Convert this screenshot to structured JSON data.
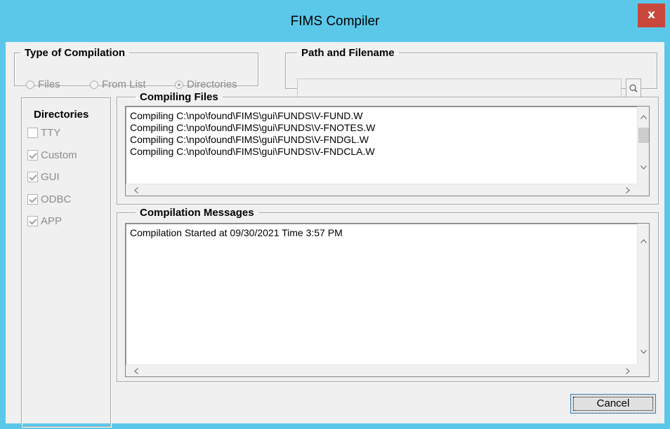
{
  "window": {
    "title": "FIMS Compiler",
    "close_label": "x"
  },
  "compilation_type": {
    "legend": "Type of Compilation",
    "options": [
      {
        "label": "Files",
        "selected": false
      },
      {
        "label": "From List",
        "selected": false
      },
      {
        "label": "Directories",
        "selected": true
      }
    ]
  },
  "path": {
    "legend": "Path and Filename",
    "value": "",
    "browse_icon": "search-icon"
  },
  "directories": {
    "heading": "Directories",
    "items": [
      {
        "label": "TTY",
        "checked": false
      },
      {
        "label": "Custom",
        "checked": true
      },
      {
        "label": "GUI",
        "checked": true
      },
      {
        "label": "ODBC",
        "checked": true
      },
      {
        "label": "APP",
        "checked": true
      }
    ]
  },
  "compiling_files": {
    "legend": "Compiling Files",
    "lines": [
      "Compiling C:\\npo\\found\\FIMS\\gui\\FUNDS\\V-FUND.W",
      "Compiling C:\\npo\\found\\FIMS\\gui\\FUNDS\\V-FNOTES.W",
      "Compiling C:\\npo\\found\\FIMS\\gui\\FUNDS\\V-FNDGL.W",
      "Compiling C:\\npo\\found\\FIMS\\gui\\FUNDS\\V-FNDCLA.W"
    ]
  },
  "messages": {
    "legend": "Compilation Messages",
    "lines": [
      "Compilation Started at 09/30/2021 Time  3:57 PM"
    ]
  },
  "buttons": {
    "cancel": "Cancel"
  },
  "colors": {
    "title_bar": "#5bc8ea",
    "close_button": "#c9483d",
    "dialog_face": "#f0f0f0"
  }
}
